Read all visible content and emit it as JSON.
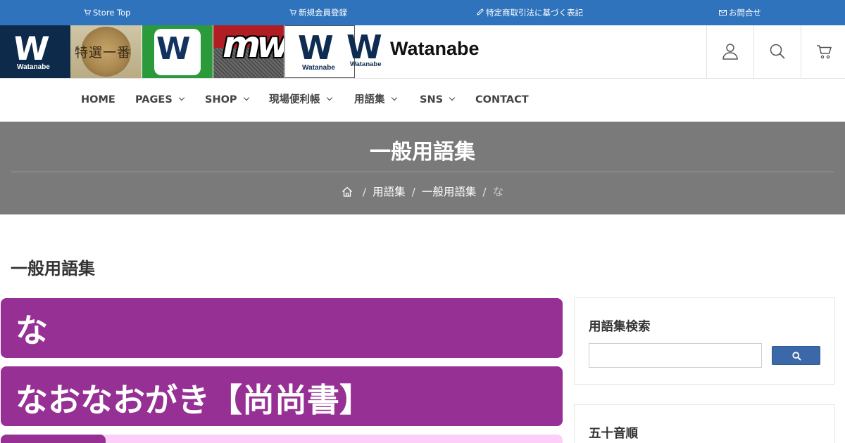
{
  "topbar": {
    "links": [
      {
        "icon": "cart-icon",
        "label": "Store Top"
      },
      {
        "icon": "cart-icon",
        "label": "新規会員登録"
      },
      {
        "icon": "pencil-icon",
        "label": "特定商取引法に基づく表記"
      },
      {
        "icon": "mail-icon",
        "label": "お問合せ"
      }
    ],
    "bg_color": "#2f73bd"
  },
  "header": {
    "tiles": [
      {
        "name": "watanabe-logo-tile",
        "text": "W",
        "sub": "Watanabe"
      },
      {
        "name": "tokusen-ichiban-tile",
        "text": "特選一番"
      },
      {
        "name": "green-w-tile",
        "text": "W"
      },
      {
        "name": "mw-tile",
        "text": "mw"
      },
      {
        "name": "watanabe-white-tile",
        "text": "W",
        "sub": "Watanabe"
      }
    ],
    "brand": {
      "mark": "W",
      "sub": "Watanabe",
      "word": "Watanabe"
    },
    "icons": [
      "user-icon",
      "search-icon",
      "cart-icon"
    ]
  },
  "nav": {
    "items": [
      {
        "label": "HOME",
        "dropdown": false
      },
      {
        "label": "PAGES",
        "dropdown": true
      },
      {
        "label": "SHOP",
        "dropdown": true
      },
      {
        "label": "現場便利帳",
        "dropdown": true
      },
      {
        "label": "用語集",
        "dropdown": true
      },
      {
        "label": "SNS",
        "dropdown": true
      },
      {
        "label": "CONTACT",
        "dropdown": false
      }
    ]
  },
  "hero": {
    "title": "一般用語集",
    "breadcrumb": [
      {
        "icon": "home-icon"
      },
      {
        "label": "用語集"
      },
      {
        "label": "一般用語集"
      },
      {
        "label": "な",
        "current": true
      }
    ],
    "bg_color": "#7a7a7a"
  },
  "main": {
    "page_title": "一般用語集",
    "section_heading": "な",
    "term_heading": "なおなおがき【尚尚書】",
    "accent_color": "#963094",
    "row_color": "#fccff8"
  },
  "sidebar": {
    "search_widget": {
      "title": "用語集検索",
      "input_value": "",
      "button_icon": "search-icon"
    },
    "index_widget": {
      "title": "五十音順"
    }
  }
}
